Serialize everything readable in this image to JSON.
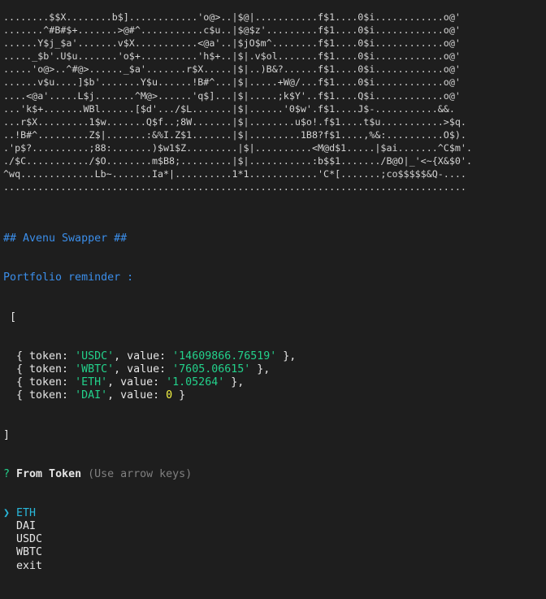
{
  "ascii_art": [
    "........$$X........b$]............'o@>..|$@|...........f$1....0$i............o@'",
    ".......^#B#$+.......>@#^...........c$u..|$@$z'.........f$1....0$i............o@'",
    "......Y$j_$a'.......v$X...........<@a'..|$jO$m^........f$1....0$i............o@'",
    "....._$b'.U$u.......'o$+..........'h$+..|$|.v$ol.......f$1....0$i............o@'",
    ".....'o@>..^#@>......_$a'.......r$X.....|$|..)B&?......f$1....0$i............o@'",
    "......v$u....]$b'.......Y$u......!B#^...|$|.....+W@/...f$1....0$i............o@'",
    "....<@a'.....L$j.......^M@>......'q$]...|$|.....;k$Y'..f$1....Q$i............o@'",
    "...'k$+.......WBl......[$d'.../$L.......|$|......'0$w'.f$1....J$-...........&&.",
    "...r$X.........1$w.......Q$f..;8W.......|$|........u$o!.f$1....t$u...........>$q.",
    "..!B#^.........Z$|.......:&%I.Z$1.......|$|.........1B8?f$1....,%&:..........O$).",
    ".'p$?..........;88:.......)$w1$Z.........|$|..........<M@d$1.....|$ai.......^C$m'.",
    "./$C.........../$O........m$B8;.........|$|...........:b$$1......./B@O|_'<~{X&$0'.",
    "^wq.............Lb~.......Ia*|..........1*1............'C*[.......;co$$$$$&Q-....",
    "................................................................................."
  ],
  "title_line": "## Avenu Swapper ##",
  "subtitle_line": "Portfolio reminder :",
  "open_bracket": " [",
  "close_bracket": "]",
  "portfolio": [
    {
      "token": "USDC",
      "value": "14609866.76519",
      "value_type": "string"
    },
    {
      "token": "WBTC",
      "value": "7605.06615",
      "value_type": "string"
    },
    {
      "token": "ETH",
      "value": "1.05264",
      "value_type": "string"
    },
    {
      "token": "DAI",
      "value": "0",
      "value_type": "number"
    }
  ],
  "prompt": {
    "mark": "?",
    "question": "From Token",
    "hint": "(Use arrow keys)",
    "pointer": "❯"
  },
  "options": [
    {
      "label": "ETH",
      "selected": true
    },
    {
      "label": "DAI",
      "selected": false
    },
    {
      "label": "USDC",
      "selected": false
    },
    {
      "label": "WBTC",
      "selected": false
    },
    {
      "label": "exit",
      "selected": false
    }
  ],
  "colors": {
    "background": "#1e1e1e",
    "heading_blue": "#3b8eea",
    "string_green": "#23d18b",
    "number_yellow": "#f5f543",
    "hint_grey": "#808080",
    "selected_cyan": "#29b8db"
  }
}
